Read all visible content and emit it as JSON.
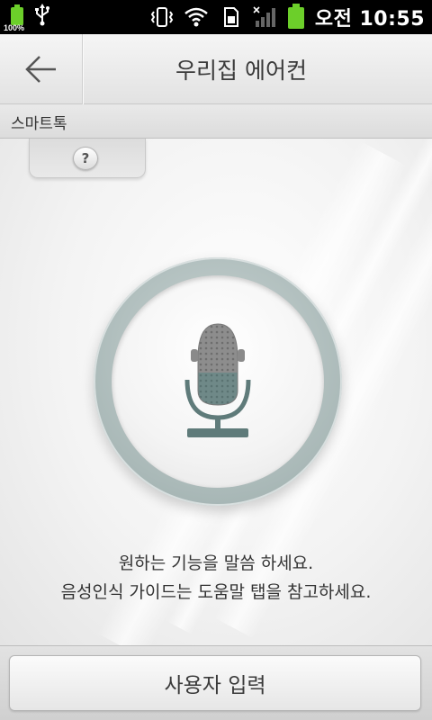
{
  "status_bar": {
    "battery_percent_label": "100%",
    "time": "오전 10:55",
    "icons": [
      "battery-icon",
      "usb-icon",
      "vibrate-icon",
      "wifi-icon",
      "sim-icon",
      "signal-icon",
      "battery-icon"
    ],
    "battery_color": "#6ccf2a"
  },
  "header": {
    "title": "우리집 에어컨",
    "back_icon": "arrow-left-icon"
  },
  "subbar": {
    "label": "스마트톡"
  },
  "help": {
    "label": "?"
  },
  "mic": {
    "icon": "microphone-icon",
    "ring_color": "#aab9b8",
    "accent_color": "#5f7b7a"
  },
  "guide": {
    "line1": "원하는 기능을 말씀 하세요.",
    "line2": "음성인식 가이드는 도움말 탭을 참고하세요."
  },
  "bottom": {
    "button_label": "사용자 입력"
  }
}
